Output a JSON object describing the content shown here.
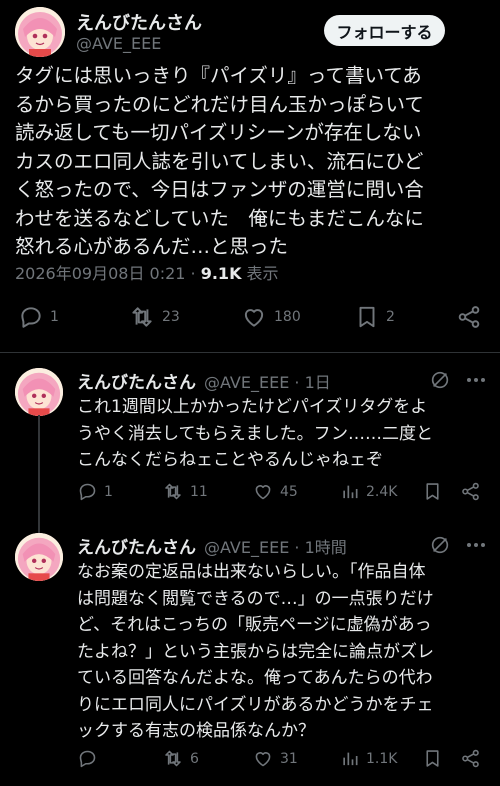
{
  "main_tweet": {
    "display_name": "えんびたんさん",
    "handle": "@AVE_EEE",
    "follow_label": "フォローする",
    "text": "タグには思いっきり『パイズリ』って書いてあ\nるから買ったのにどれだけ目ん玉かっぽらいて\n読み返しても一切パイズリシーンが存在しない\nカスのエロ同人誌を引いてしまい、流石にひど\nく怒ったので、今日はファンザの運営に問い合\nわせを送るなどしていた　俺にもまだこんなに\n怒れる心があるんだ…と思った",
    "timestamp": "2026年09月08日 0:21 · ",
    "views_count": "9.1K",
    "views_label": " 表示",
    "stats": {
      "replies": "1",
      "retweets": "23",
      "likes": "180",
      "bookmarks": "2"
    }
  },
  "replies": [
    {
      "display_name": "えんびたんさん",
      "handle_time": "@AVE_EEE · 1日",
      "text": "これ1週間以上かかったけどパイズリタグをよ\nうやく消去してもらえました。フン……二度と\nこんなくだらねェことやるんじゃねェぞ",
      "stats": {
        "replies": "1",
        "retweets": "11",
        "likes": "45",
        "views": "2.4K"
      }
    },
    {
      "display_name": "えんびたんさん",
      "handle_time": "@AVE_EEE · 1時間",
      "text": "なお案の定返品は出来ないらしい。「作品自体\nは問題なく閲覧できるので…」の一点張りだけ\nど、それはこっちの「販売ページに虚偽があっ\nたよね？」という主張からは完全に論点がズレ\nている回答なんだよな。俺ってあんたらの代わ\nりにエロ同人にパイズリがあるかどうかをチェ\nックする有志の検品係なんか？",
      "stats": {
        "replies": "",
        "retweets": "6",
        "likes": "31",
        "views": "1.1K"
      }
    }
  ],
  "colors": {
    "background": "#000000",
    "text": "#e7e9ea",
    "muted": "#71767b",
    "divider": "#2f3336",
    "follow_bg": "#eff3f4"
  },
  "icons": [
    "avatar",
    "reply-icon",
    "retweet-icon",
    "like-icon",
    "bookmark-icon",
    "share-icon",
    "views-icon",
    "grok-icon"
  ]
}
